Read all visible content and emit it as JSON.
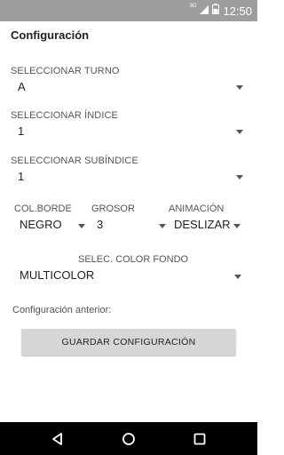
{
  "status_bar": {
    "network": "3G",
    "time": "12:50"
  },
  "screen_title": "Configuración",
  "turno": {
    "label": "SELECCIONAR TURNO",
    "value": "A"
  },
  "indice": {
    "label": "SELECCIONAR ÍNDICE",
    "value": "1"
  },
  "subindice": {
    "label": "SELECCIONAR SUBÍNDICE",
    "value": "1"
  },
  "col_borde": {
    "label": "COL.BORDE",
    "value": "NEGRO"
  },
  "grosor": {
    "label": "GROSOR",
    "value": "3"
  },
  "animacion": {
    "label": "ANIMACIÓN",
    "value": "DESLIZAR"
  },
  "color_fondo": {
    "label": "SELEC. COLOR FONDO",
    "value": "MULTICOLOR"
  },
  "previous_config_label": "Configuración anterior:",
  "save_button_label": "GUARDAR CONFIGURACIÓN",
  "icons": {
    "status": [
      "signal-icon",
      "battery-icon"
    ],
    "nav": [
      "back-icon",
      "home-icon",
      "recents-icon"
    ]
  },
  "colors": {
    "status_bar": "#9e9e9e",
    "button": "#d6d6d6",
    "nav_bar": "#000000"
  }
}
